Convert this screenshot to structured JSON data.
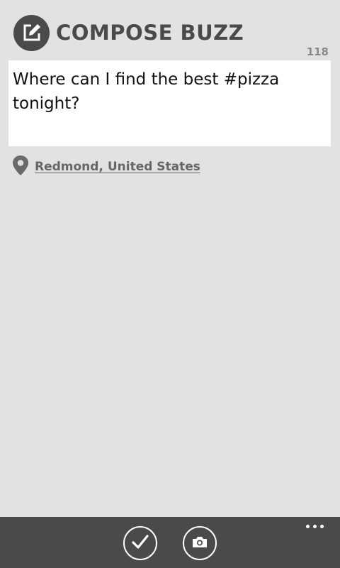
{
  "header": {
    "title": "COMPOSE BUZZ",
    "icon": "compose-icon"
  },
  "composer": {
    "char_count": "118",
    "message": "Where can I find the best #pizza tonight?"
  },
  "location": {
    "icon": "map-pin-icon",
    "label": "Redmond, United States"
  },
  "app_bar": {
    "buttons": [
      {
        "name": "send",
        "icon": "check-icon"
      },
      {
        "name": "attach-photo",
        "icon": "camera-icon"
      }
    ],
    "more_icon": "more-dots-icon"
  },
  "colors": {
    "background": "#e2e2e2",
    "dark": "#4a4a4a",
    "muted": "#8a8a8a",
    "link": "#666666",
    "input_bg": "#ffffff"
  }
}
